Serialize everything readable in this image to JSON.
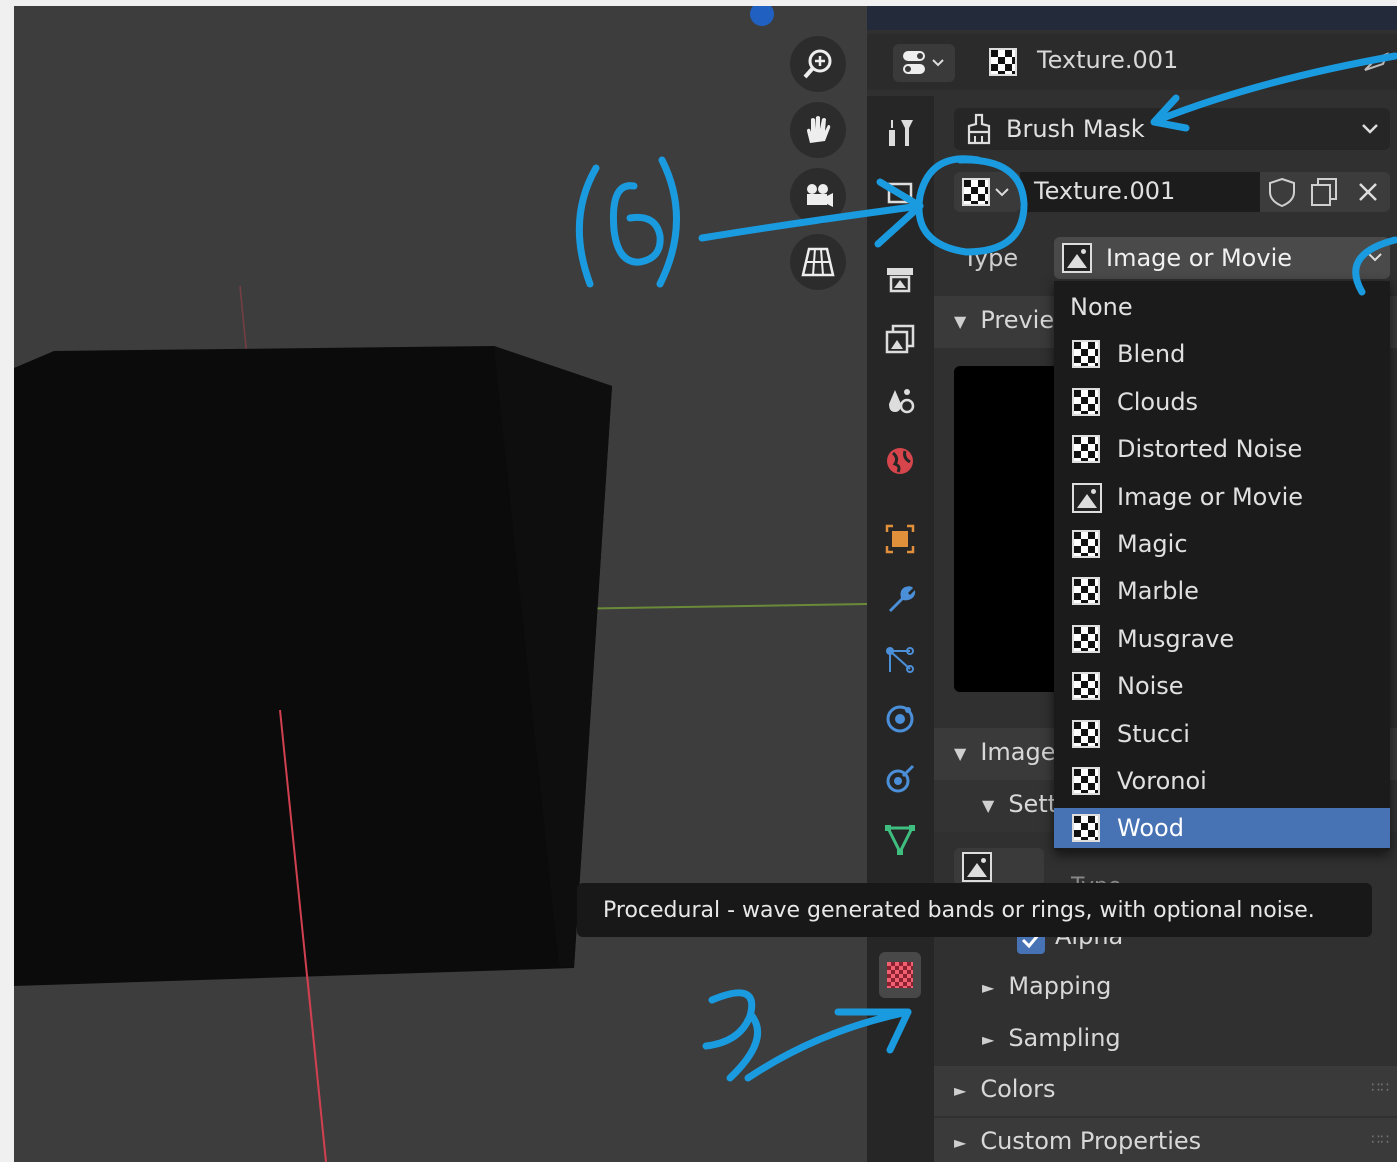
{
  "header": {
    "texture_name": "Texture.001"
  },
  "context": {
    "mode_label": "Brush Mask"
  },
  "texture_slot": {
    "name": "Texture.001"
  },
  "type_field": {
    "label": "Type",
    "value": "Image or Movie"
  },
  "panels": {
    "preview": "Preview",
    "image": "Image",
    "settings": "Settings",
    "alpha": "Alpha",
    "mapping": "Mapping",
    "sampling": "Sampling",
    "colors": "Colors",
    "custom_properties": "Custom Properties",
    "image_type_label": "Type"
  },
  "type_menu": {
    "items": [
      {
        "label": "None",
        "icon": "none",
        "selected": false
      },
      {
        "label": "Blend",
        "icon": "checker-icon",
        "selected": false
      },
      {
        "label": "Clouds",
        "icon": "checker-icon",
        "selected": false
      },
      {
        "label": "Distorted Noise",
        "icon": "checker-icon",
        "selected": false
      },
      {
        "label": "Image or Movie",
        "icon": "image-icon",
        "selected": false
      },
      {
        "label": "Magic",
        "icon": "checker-icon",
        "selected": false
      },
      {
        "label": "Marble",
        "icon": "checker-icon",
        "selected": false
      },
      {
        "label": "Musgrave",
        "icon": "checker-icon",
        "selected": false
      },
      {
        "label": "Noise",
        "icon": "checker-icon",
        "selected": false
      },
      {
        "label": "Stucci",
        "icon": "checker-icon",
        "selected": false
      },
      {
        "label": "Voronoi",
        "icon": "checker-icon",
        "selected": false
      },
      {
        "label": "Wood",
        "icon": "checker-icon",
        "selected": true
      }
    ]
  },
  "tooltip": {
    "text": "Procedural - wave generated bands or rings, with optional noise."
  },
  "annotations": {
    "label_six": "(6)",
    "label_three": "3"
  },
  "colors": {
    "accent": "#4772b3",
    "annotation": "#1a9be0",
    "active_tab": "#e8505b"
  }
}
